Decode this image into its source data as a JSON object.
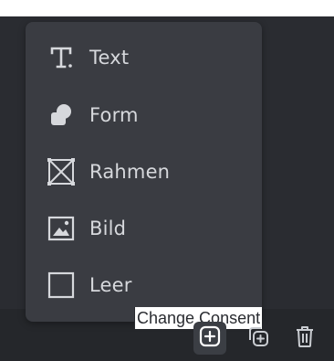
{
  "menu": {
    "items": [
      {
        "label": "Text",
        "icon": "text-icon"
      },
      {
        "label": "Form",
        "icon": "shape-icon"
      },
      {
        "label": "Rahmen",
        "icon": "frame-icon"
      },
      {
        "label": "Bild",
        "icon": "image-icon"
      },
      {
        "label": "Leer",
        "icon": "empty-square-icon"
      }
    ]
  },
  "tooltip": {
    "text": "Change Consent"
  },
  "toolbar": {
    "buttons": [
      {
        "icon": "add-page-icon",
        "active": true
      },
      {
        "icon": "duplicate-page-icon",
        "active": false
      },
      {
        "icon": "trash-icon",
        "active": false
      }
    ]
  },
  "colors": {
    "background": "#2a2c31",
    "menu": "#3a3c42",
    "text": "#d6d8dc",
    "tooltip_bg": "#ffffff"
  }
}
